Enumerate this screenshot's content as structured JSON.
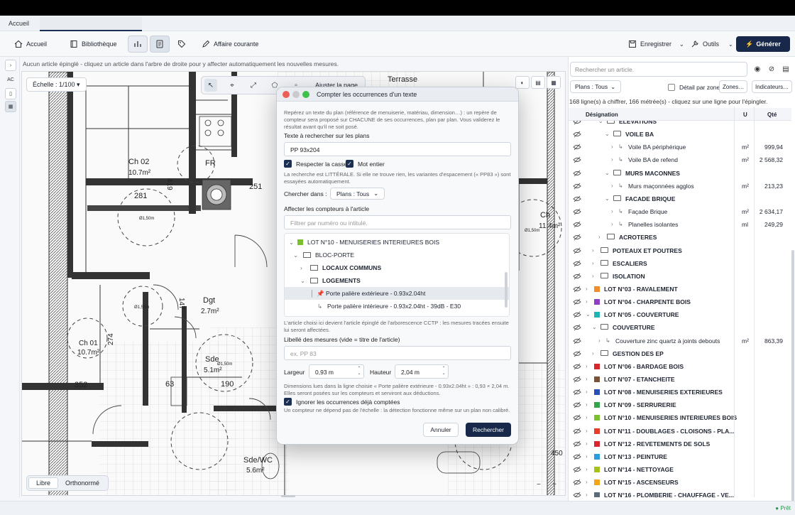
{
  "tabs": {
    "home": "Accueil"
  },
  "toolbar": {
    "home": "Accueil",
    "library": "Bibliothèque",
    "current_case": "Affaire courante",
    "save": "Enregistrer",
    "tools": "Outils",
    "generate": "Générer"
  },
  "left_strip": {
    "ac": "AC"
  },
  "hint": "Aucun article épinglé - cliquez un article dans l'arbre de droite pour y affecter automatiquement les nouvelles mesures.",
  "plan": {
    "scale": "Échelle : 1/100 ▾",
    "mode_free": "Libre",
    "mode_ortho": "Orthonormé",
    "fit_page": "Ajuster la page",
    "labels": {
      "terrasse": "Terrasse",
      "ch02": "Ch 02",
      "ch02_area": "10.7m²",
      "n281": "281",
      "n419": "419",
      "n251": "251",
      "fr": "FR",
      "ch_left": "Ch 01",
      "ch_left_area": "10.7m²",
      "n274": "274",
      "n352": "352",
      "dgt": "Dgt",
      "dgt_area": "2.7m²",
      "n147": "147",
      "sde": "Sde",
      "sde_area": "5.1m²",
      "n63": "63",
      "n190": "190",
      "swc": "Sde/WC",
      "swc_area": "5.6m²",
      "ch_right": "Ch",
      "ch_right_area": "11.4m²",
      "n450": "450",
      "d1": "Ø1,50m",
      "d2": "Ø1,50m",
      "d3": "Ø1,50m",
      "d4": "Ø1,50m"
    },
    "zoom_minus": "−",
    "zoom_plus": "+"
  },
  "modal": {
    "title": "Compter les occurrences d'un texte",
    "intro": "Repérez un texte du plan (référence de menuiserie, matériau, dimension…) : un repère de compteur sera proposé sur CHACUNE de ses occurrences, plan par plan. Vous validerez le résultat avant qu'il ne soit posé.",
    "search_label": "Texte à rechercher sur les plans",
    "search_value": "PP 93x204",
    "case_label": "Respecter la casse",
    "word_label": "Mot entier",
    "literal_note": "La recherche est LITTÉRALE. Si elle ne trouve rien, les variantes d'espacement (« PP83 ») sont essayées automatiquement.",
    "search_in_label": "Chercher dans :",
    "search_in_value": "Plans : Tous",
    "assign_label": "Affecter les compteurs à l'article",
    "filter_placeholder": "Filtrer par numéro ou intitulé.",
    "tree": [
      {
        "label": "LOT N°10 - MENUISERIES INTERIEURES BOIS"
      },
      {
        "label": "BLOC-PORTE"
      },
      {
        "label": "LOCAUX COMMUNS"
      },
      {
        "label": "LOGEMENTS"
      },
      {
        "label": "Porte palière extérieure - 0.93x2.04ht"
      },
      {
        "label": "Porte palière intérieure - 0.93x2.04ht - 39dB - E30"
      }
    ],
    "tree_note": "L'article choisi ici devient l'article épinglé de l'arborescence CCTP : les mesures tracées ensuite lui seront affectées.",
    "caption_label": "Libellé des mesures (vide = titre de l'article)",
    "caption_placeholder": "ex. PP 83",
    "width_label": "Largeur",
    "width_value": "0,93 m",
    "height_label": "Hauteur",
    "height_value": "2,04 m",
    "dims_note": "Dimensions lues dans la ligne choisie « Porte palière extérieure - 0.93x2.04ht » : 0,93 × 2,04 m. Elles seront posées sur les compteurs et serviront aux déductions.",
    "ignore_label": "Ignorer les occurrences déjà comptées",
    "ignore_note": "Un compteur ne dépend pas de l'échelle : la détection fonctionne même sur un plan non calibré.",
    "cancel": "Annuler",
    "search": "Rechercher"
  },
  "right_panel": {
    "search_placeholder": "Rechercher un article.",
    "plans_filter": "Plans : Tous",
    "detail_label": "Détail par zone",
    "zones_btn": "Zones…",
    "indicators_btn": "Indicateurs…",
    "count_text": "168 ligne(s) à chiffrer, 166 métrée(s) - cliquez sur une ligne pour l'épingler.",
    "col_designation": "Désignation",
    "col_unit": "U",
    "col_qty": "Qté",
    "rows": [
      {
        "label": "ELEVATIONS",
        "unit": "",
        "qty": ""
      },
      {
        "label": "VOILE BA",
        "unit": "",
        "qty": ""
      },
      {
        "label": "Voile BA périphérique",
        "unit": "m²",
        "qty": "999,94"
      },
      {
        "label": "Voile BA de refend",
        "unit": "m²",
        "qty": "2 568,32"
      },
      {
        "label": "MURS MACONNES",
        "unit": "",
        "qty": ""
      },
      {
        "label": "Murs maçonnées agglos",
        "unit": "m²",
        "qty": "213,23"
      },
      {
        "label": "FACADE BRIQUE",
        "unit": "",
        "qty": ""
      },
      {
        "label": "Façade Brique",
        "unit": "m²",
        "qty": "2 634,17"
      },
      {
        "label": "Planelles isolantes",
        "unit": "ml",
        "qty": "249,29"
      },
      {
        "label": "ACROTERES",
        "unit": "",
        "qty": ""
      },
      {
        "label": "POTEAUX ET POUTRES",
        "unit": "",
        "qty": ""
      },
      {
        "label": "ESCALIERS",
        "unit": "",
        "qty": ""
      },
      {
        "label": "ISOLATION",
        "unit": "",
        "qty": ""
      },
      {
        "label": "LOT N°03 - RAVALEMENT",
        "unit": "",
        "qty": ""
      },
      {
        "label": "LOT N°04 - CHARPENTE BOIS",
        "unit": "",
        "qty": ""
      },
      {
        "label": "LOT N°05 - COUVERTURE",
        "unit": "",
        "qty": ""
      },
      {
        "label": "COUVERTURE",
        "unit": "",
        "qty": ""
      },
      {
        "label": "Couverture zinc quartz à joints debouts",
        "unit": "m²",
        "qty": "863,39"
      },
      {
        "label": "GESTION DES EP",
        "unit": "",
        "qty": ""
      },
      {
        "label": "LOT N°06 - BARDAGE BOIS",
        "unit": "",
        "qty": ""
      },
      {
        "label": "LOT N°07 - ETANCHEITE",
        "unit": "",
        "qty": ""
      },
      {
        "label": "LOT N°08 - MENUISERIES EXTERIEURES",
        "unit": "",
        "qty": ""
      },
      {
        "label": "LOT N°09 - SERRURERIE",
        "unit": "",
        "qty": ""
      },
      {
        "label": "LOT N°10 - MENUISERIES INTERIEURES BOIS",
        "unit": "",
        "qty": ""
      },
      {
        "label": "LOT N°11 - DOUBLAGES - CLOISONS - PLA...",
        "unit": "",
        "qty": ""
      },
      {
        "label": "LOT N°12 - REVETEMENTS DE SOLS",
        "unit": "",
        "qty": ""
      },
      {
        "label": "LOT N°13 - PEINTURE",
        "unit": "",
        "qty": ""
      },
      {
        "label": "LOT N°14 - NETTOYAGE",
        "unit": "",
        "qty": ""
      },
      {
        "label": "LOT N°15 - ASCENSEURS",
        "unit": "",
        "qty": ""
      },
      {
        "label": "LOT N°16 - PLOMBERIE - CHAUFFAGE - VE...",
        "unit": "",
        "qty": ""
      }
    ],
    "lot_colors": {
      "lot03": "#f28c28",
      "lot04": "#8e3ec7",
      "lot05": "#1fb3b3",
      "lot06": "#d6262e",
      "lot07": "#7a5236",
      "lot08": "#2b4eb8",
      "lot09": "#34a34a",
      "lot10": "#7cbf2f",
      "lot11": "#e83d2a",
      "lot12": "#d9232e",
      "lot13": "#2d9be0",
      "lot14": "#a5c21a",
      "lot15": "#f2a516",
      "lot16": "#5b6b78"
    }
  },
  "status": {
    "ready": "Prêt"
  }
}
